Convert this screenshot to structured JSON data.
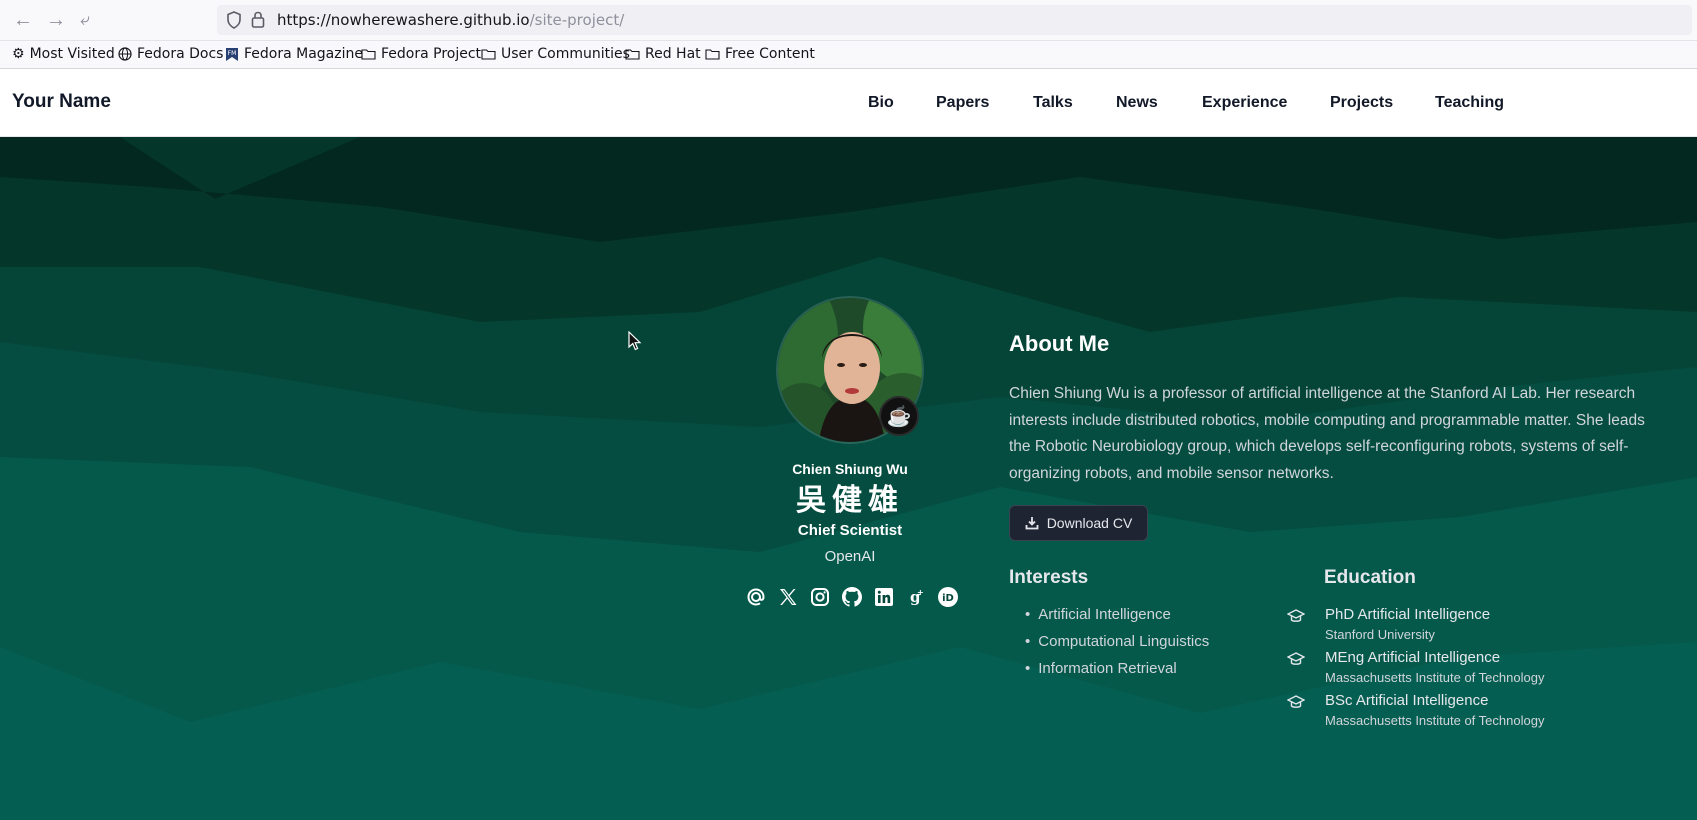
{
  "browser": {
    "url_host": "https://nowherewashere.github.io",
    "url_path": "/site-project/",
    "bookmarks": [
      {
        "label": "Most Visited",
        "icon": "gear-icon"
      },
      {
        "label": "Fedora Docs",
        "icon": "globe-icon"
      },
      {
        "label": "Fedora Magazine",
        "icon": "fedora-magazine-icon"
      },
      {
        "label": "Fedora Project",
        "icon": "folder-icon"
      },
      {
        "label": "User Communities",
        "icon": "folder-icon"
      },
      {
        "label": "Red Hat",
        "icon": "folder-icon"
      },
      {
        "label": "Free Content",
        "icon": "folder-icon"
      }
    ]
  },
  "header": {
    "brand": "Your Name",
    "nav": [
      "Bio",
      "Papers",
      "Talks",
      "News",
      "Experience",
      "Projects",
      "Teaching"
    ]
  },
  "profile": {
    "name": "Chien Shiung Wu",
    "chinese_name": "吳健雄",
    "role": "Chief Scientist",
    "organization": "OpenAI",
    "status_icon": "coffee-icon",
    "socials": [
      "email-icon",
      "x-icon",
      "instagram-icon",
      "github-icon",
      "linkedin-icon",
      "google-scholar-icon",
      "orcid-icon"
    ]
  },
  "about": {
    "title": "About Me",
    "bio": "Chien Shiung Wu is a professor of artificial intelligence at the Stanford AI Lab. Her research interests include distributed robotics, mobile computing and programmable matter. She leads the Robotic Neurobiology group, which develops self-reconfiguring robots, systems of self-organizing robots, and mobile sensor networks.",
    "cv_button": "Download CV"
  },
  "interests": {
    "title": "Interests",
    "items": [
      "Artificial Intelligence",
      "Computational Linguistics",
      "Information Retrieval"
    ]
  },
  "education": {
    "title": "Education",
    "items": [
      {
        "degree": "PhD Artificial Intelligence",
        "institution": "Stanford University"
      },
      {
        "degree": "MEng Artificial Intelligence",
        "institution": "Massachusetts Institute of Technology"
      },
      {
        "degree": "BSc Artificial Intelligence",
        "institution": "Massachusetts Institute of Technology"
      }
    ]
  },
  "colors": {
    "hero_dark": "#04362a",
    "hero_light": "#055e52",
    "accent": "#1f2433"
  }
}
